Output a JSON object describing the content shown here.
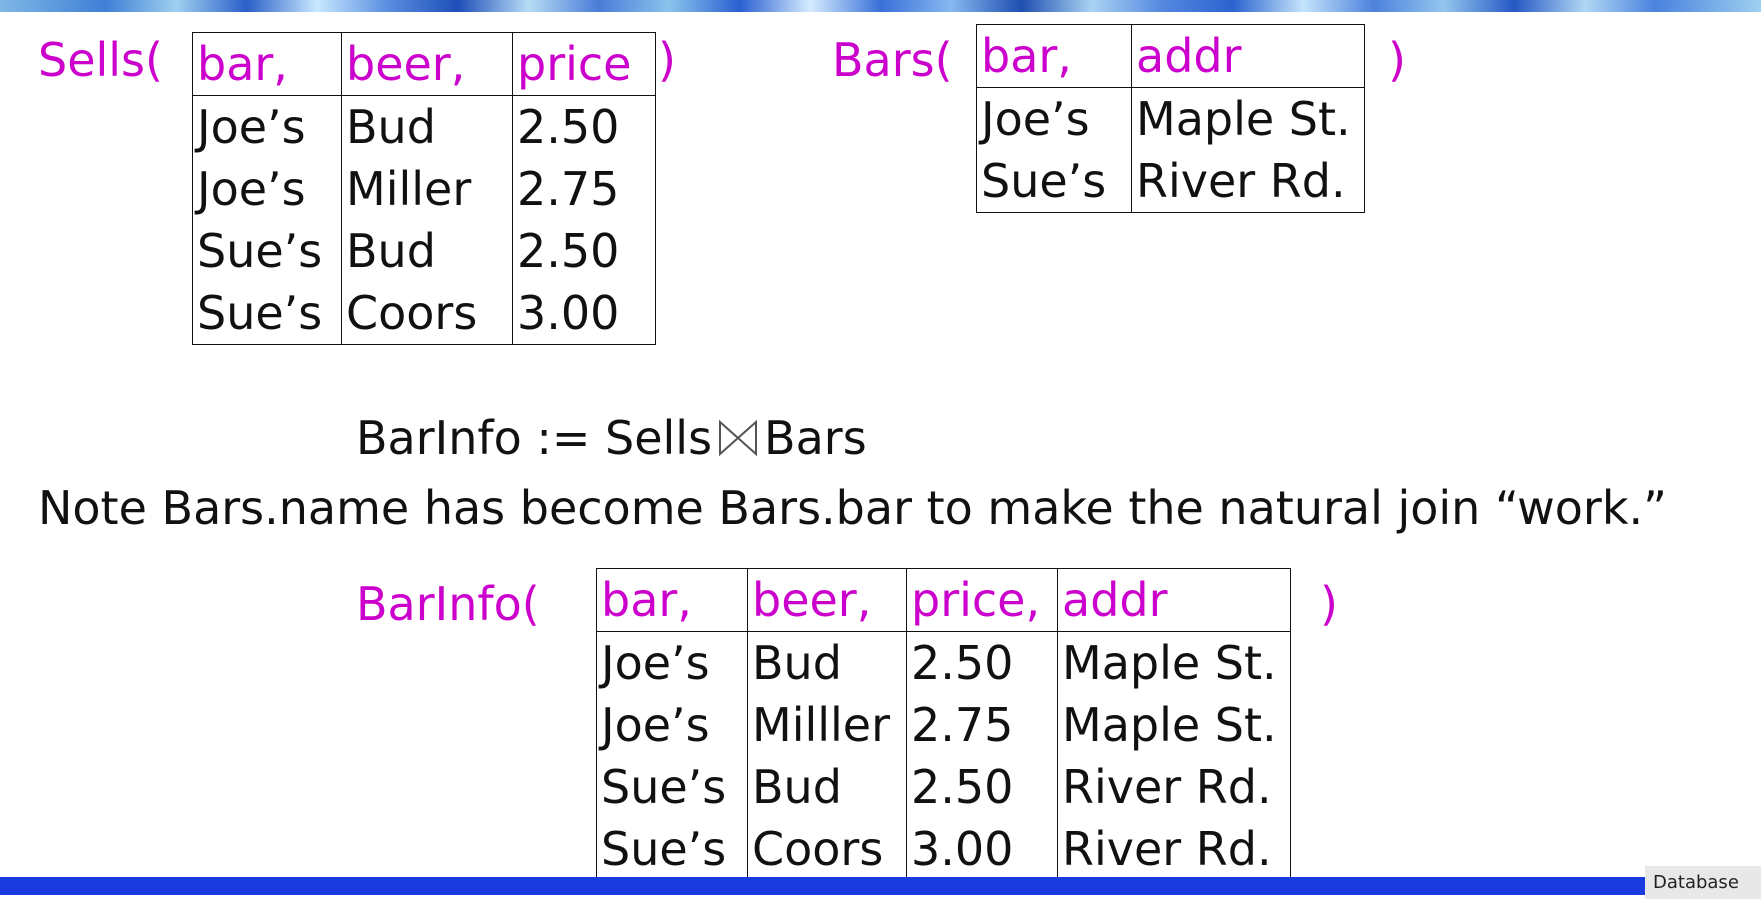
{
  "sells": {
    "label": "Sells(",
    "close": ")",
    "columns": [
      "bar,",
      "beer,",
      "price"
    ],
    "rows": [
      [
        "Joe’s",
        "Bud",
        "2.50"
      ],
      [
        "Joe’s",
        "Miller",
        "2.75"
      ],
      [
        "Sue’s",
        "Bud",
        "2.50"
      ],
      [
        "Sue’s",
        "Coors",
        "3.00"
      ]
    ]
  },
  "bars": {
    "label": "Bars(",
    "close": ")",
    "columns": [
      "bar,",
      "addr"
    ],
    "rows": [
      [
        "Joe’s",
        "Maple St."
      ],
      [
        "Sue’s",
        "River Rd."
      ]
    ]
  },
  "expression": {
    "lhs": "BarInfo := Sells",
    "rhs": "Bars",
    "operator_icon": "natural-join-bowtie-icon"
  },
  "note": "Note Bars.name has become Bars.bar to make the natural join “work.”",
  "barinfo": {
    "label": "BarInfo(",
    "close": ")",
    "columns": [
      "bar,",
      "beer,",
      "price,",
      "addr"
    ],
    "rows": [
      [
        "Joe’s",
        "Bud",
        "2.50",
        "Maple St."
      ],
      [
        "Joe’s",
        "Milller",
        "2.75",
        "Maple St."
      ],
      [
        "Sue’s",
        "Bud",
        "2.50",
        "River Rd."
      ],
      [
        "Sue’s",
        "Coors",
        "3.00",
        "River Rd."
      ]
    ]
  },
  "footer": {
    "tag": "Database"
  },
  "colors": {
    "attribute": "#cc00cc",
    "text": "#111111",
    "footer_band": "#1a3be0"
  }
}
